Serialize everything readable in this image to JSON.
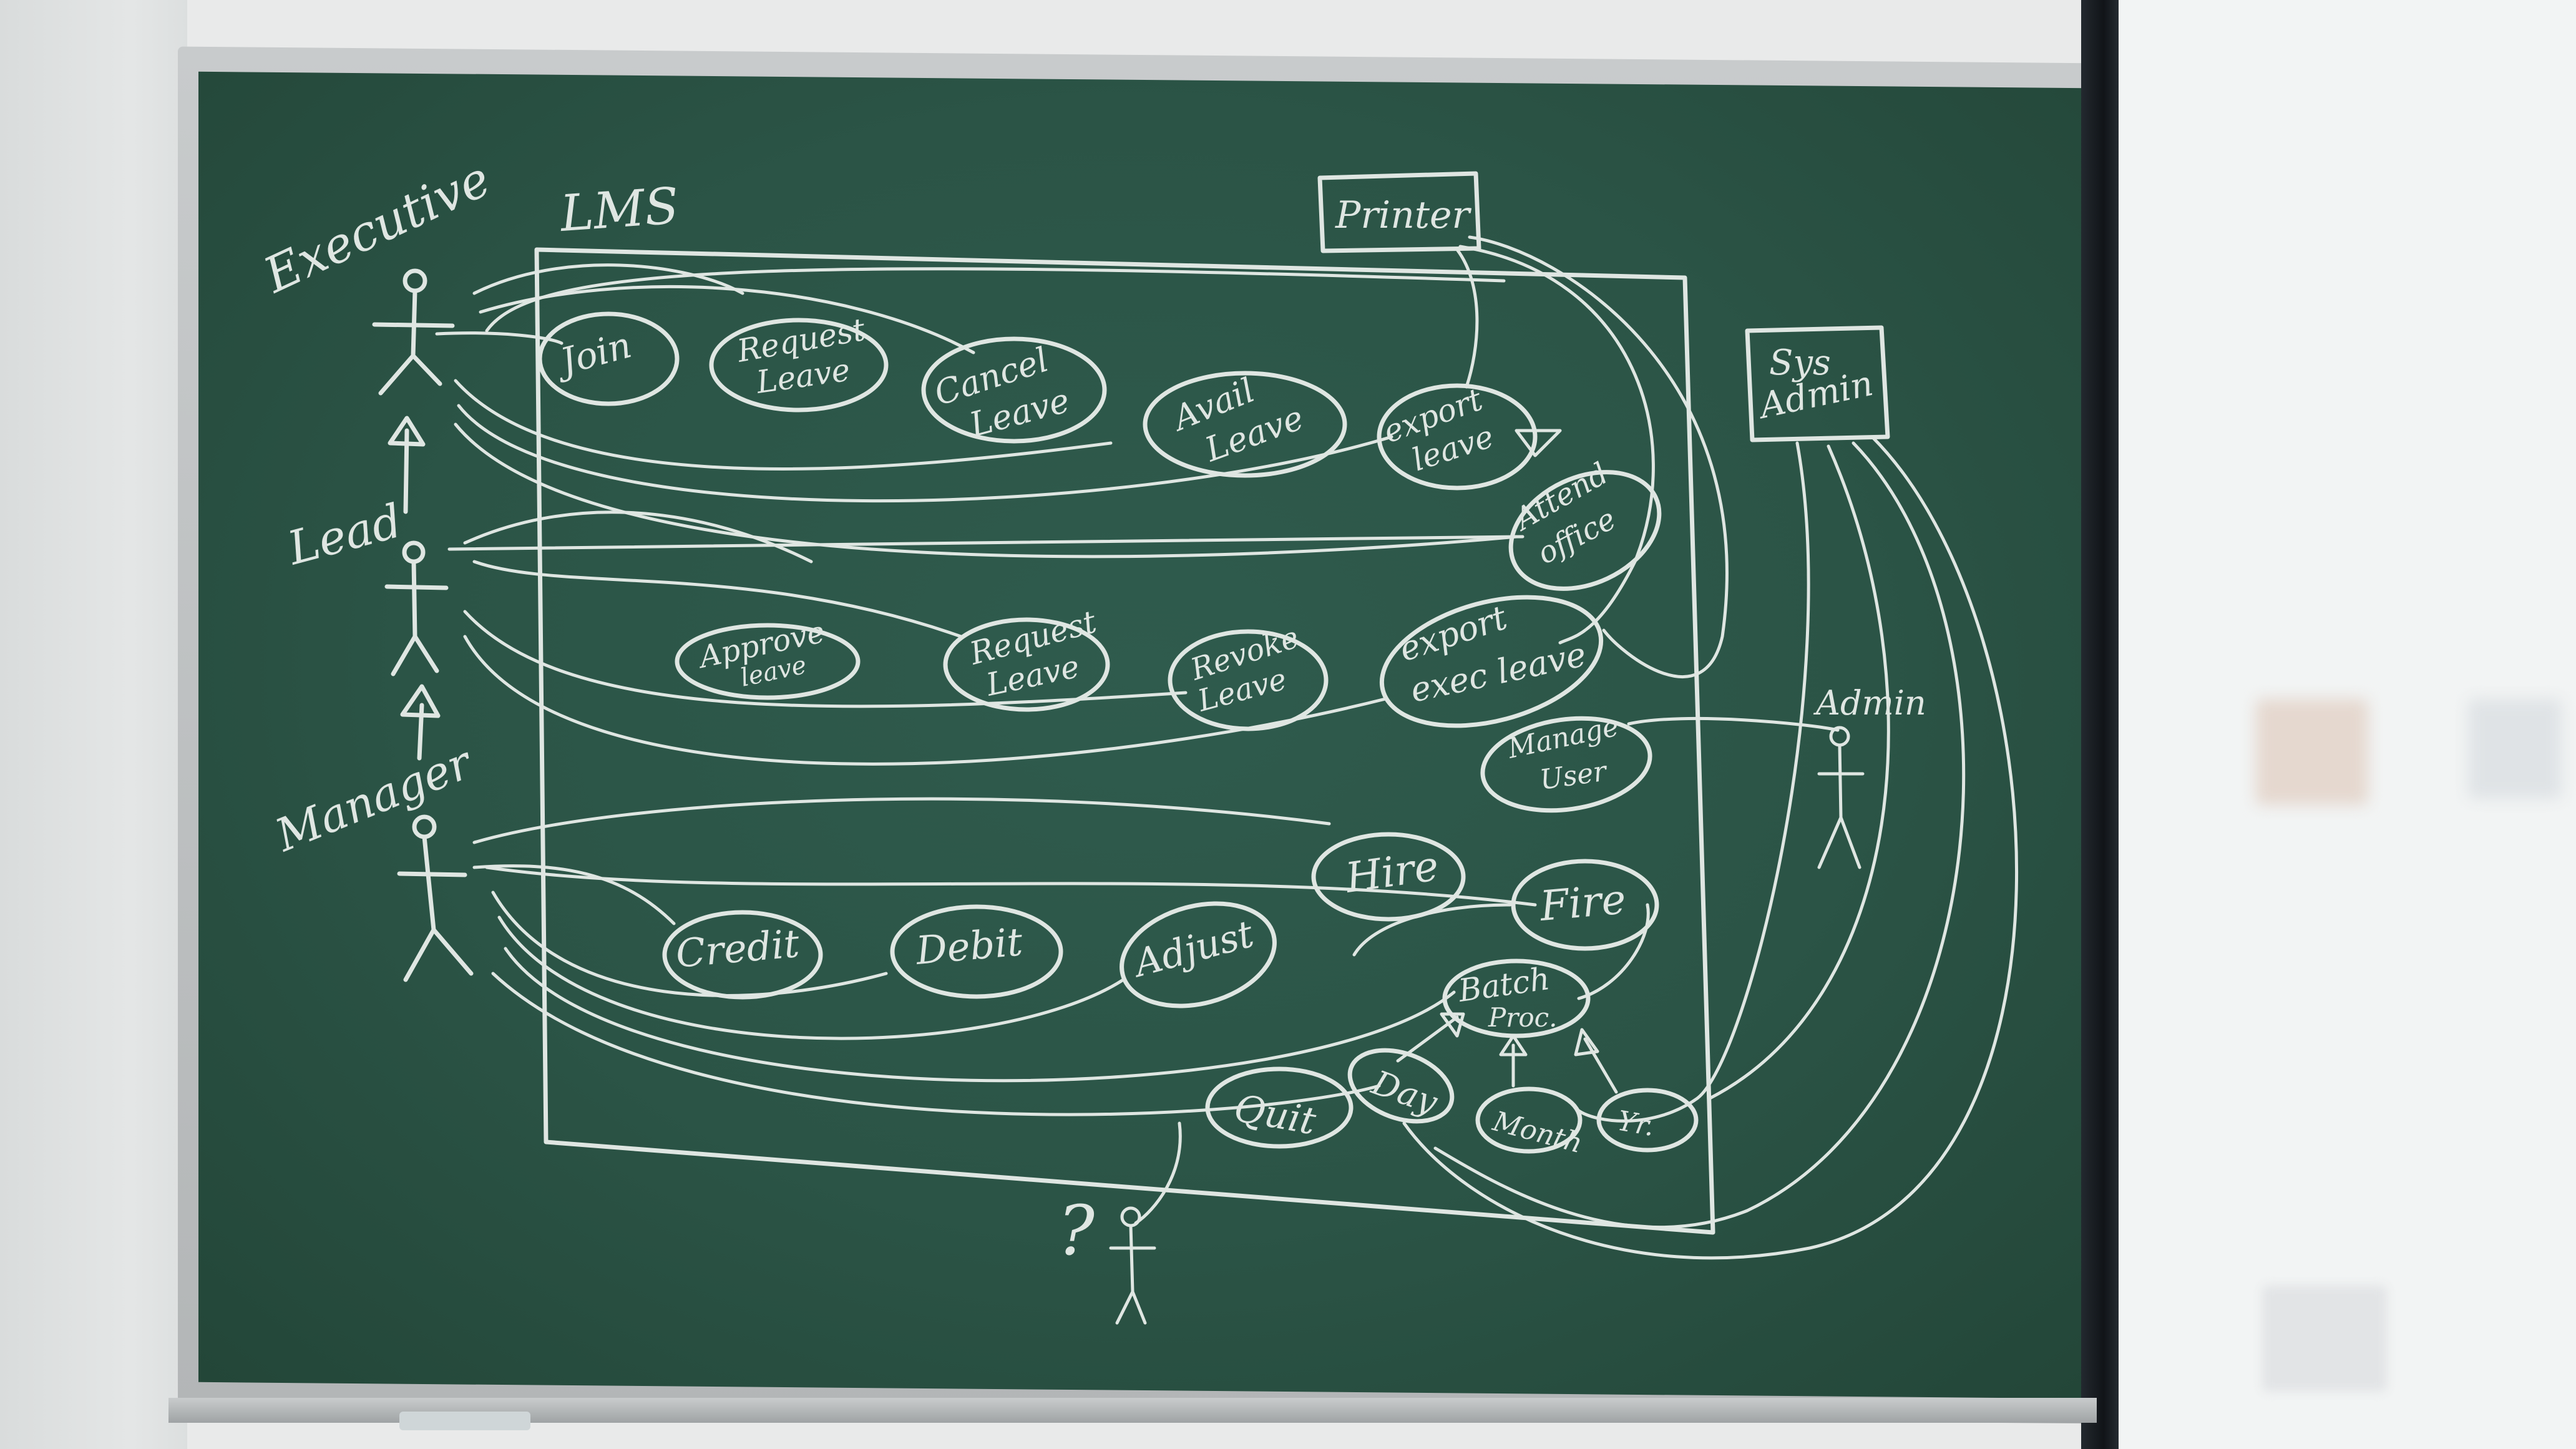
{
  "board": {
    "system_label": "LMS",
    "actors": {
      "executive": "Executive",
      "lead": "Lead",
      "manager": "Manager",
      "admin": "Admin",
      "unknown": "?"
    },
    "external_boxes": {
      "printer": "Printer",
      "sys_admin_line1": "Sys",
      "sys_admin_line2": "Admin"
    },
    "use_cases": {
      "join": "Join",
      "request_leave_1": [
        "Request",
        "Leave"
      ],
      "cancel_leave": [
        "Cancel",
        "Leave"
      ],
      "avail_leave": [
        "Avail",
        "Leave"
      ],
      "export_leave": [
        "export",
        "leave"
      ],
      "attend_office": [
        "Attend",
        "office"
      ],
      "approve_leave": [
        "Approve",
        "leave"
      ],
      "request_leave_2": [
        "Request",
        "Leave"
      ],
      "revoke_leave": [
        "Revoke",
        "Leave"
      ],
      "export_exec_leave": [
        "export",
        "exec leave"
      ],
      "manage_user": [
        "Manage",
        "User"
      ],
      "hire": "Hire",
      "fire": "Fire",
      "credit": "Credit",
      "debit": "Debit",
      "adjust": "Adjust",
      "batch_proc": [
        "Batch",
        "Proc."
      ],
      "day": "Day",
      "month": "Month",
      "yr": "Yr.",
      "quit": "Quit"
    }
  },
  "colors": {
    "board": "#2b5446",
    "chalk": "#dfe6e2",
    "frame": "#b9bcbd",
    "wall": "#e6e8e8"
  }
}
